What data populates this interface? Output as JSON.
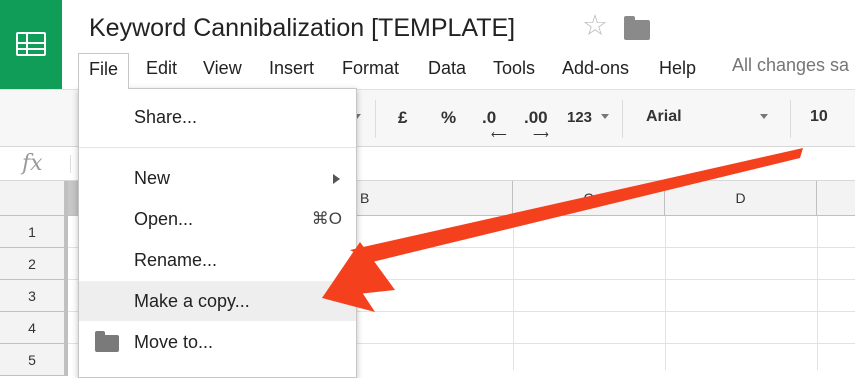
{
  "app": {
    "logo_icon": "sheets-logo-icon",
    "brand_color": "#0f9d58"
  },
  "document": {
    "title": "Keyword Cannibalization [TEMPLATE]",
    "star_icon": "star-icon",
    "folder_icon": "folder-icon"
  },
  "menubar": {
    "items": [
      {
        "label": "File"
      },
      {
        "label": "Edit"
      },
      {
        "label": "View"
      },
      {
        "label": "Insert"
      },
      {
        "label": "Format"
      },
      {
        "label": "Data"
      },
      {
        "label": "Tools"
      },
      {
        "label": "Add-ons"
      },
      {
        "label": "Help"
      }
    ],
    "save_status": "All changes sa"
  },
  "toolbar": {
    "currency": "£",
    "percent": "%",
    "decrease_decimal": ".0",
    "increase_decimal": ".00",
    "more_formats": "123",
    "font": "Arial",
    "font_size": "10"
  },
  "formula_bar": {
    "fx_label": "fx"
  },
  "grid": {
    "columns": [
      "B",
      "C",
      "D"
    ],
    "rows": [
      "1",
      "2",
      "3",
      "4",
      "5"
    ]
  },
  "file_menu": {
    "share": "Share...",
    "new": "New",
    "open": "Open...",
    "open_shortcut": "⌘O",
    "rename": "Rename...",
    "make_copy": "Make a copy...",
    "move_to": "Move to..."
  },
  "annotation": {
    "color": "#f4401c"
  }
}
